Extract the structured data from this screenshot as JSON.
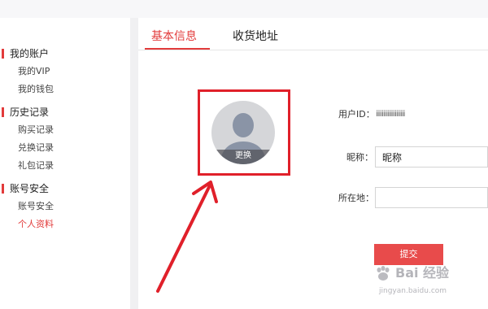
{
  "sidebar": {
    "sections": [
      {
        "title": "我的账户",
        "items": [
          "我的VIP",
          "我的钱包"
        ]
      },
      {
        "title": "历史记录",
        "items": [
          "购买记录",
          "兑换记录",
          "礼包记录"
        ]
      },
      {
        "title": "账号安全",
        "items": [
          "账号安全",
          "个人资料"
        ]
      }
    ],
    "active_item": "个人资料"
  },
  "tabs": [
    {
      "label": "基本信息",
      "active": true
    },
    {
      "label": "收货地址",
      "active": false
    }
  ],
  "avatar": {
    "change_label": "更换"
  },
  "form": {
    "user_id_label": "用户ID：",
    "user_id_value": "iiiiiiiiiiiiiiiiiiii",
    "nickname_label": "昵称：",
    "nickname_value": "昵称",
    "location_label": "所在地：",
    "location_value": "",
    "submit_label": "提交"
  },
  "watermark": {
    "text": "Bai 经验",
    "url": "jingyan.baidu.com"
  },
  "colors": {
    "accent": "#e23b3b",
    "annotation": "#e0202a",
    "submit": "#e84b4b"
  }
}
